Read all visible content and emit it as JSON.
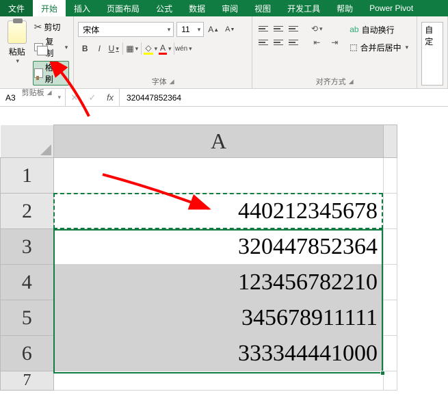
{
  "menubar": {
    "file": "文件",
    "home": "开始",
    "insert": "插入",
    "layout": "页面布局",
    "formulas": "公式",
    "data": "数据",
    "review": "审阅",
    "view": "视图",
    "devtools": "开发工具",
    "help": "帮助",
    "powerpivot": "Power Pivot"
  },
  "ribbon": {
    "clipboard": {
      "paste": "粘贴",
      "cut": "剪切",
      "copy": "复制",
      "format_painter": "格式刷",
      "group_label": "剪贴板"
    },
    "font": {
      "font_name": "宋体",
      "font_size": "11",
      "group_label": "字体",
      "bold": "B",
      "italic": "I",
      "underline": "U",
      "phonetic": "wén"
    },
    "align": {
      "wrap": "自动换行",
      "merge": "合并后居中",
      "group_label": "对齐方式"
    },
    "cells": {
      "auto": "自定"
    }
  },
  "namebox": "A3",
  "formula_value": "320447852364",
  "fx_label": "fx",
  "grid": {
    "col_a_label": "A",
    "row_labels": [
      "1",
      "2",
      "3",
      "4",
      "5",
      "6",
      "7"
    ],
    "cells": {
      "r1": "",
      "r2": "440212345678",
      "r3": "320447852364",
      "r4": "123456782210",
      "r5": "345678911111",
      "r6": "333344441000"
    }
  }
}
